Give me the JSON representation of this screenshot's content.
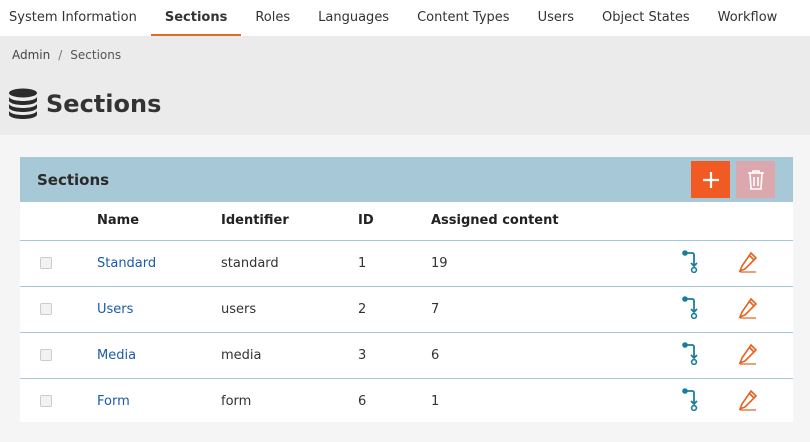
{
  "topnav": {
    "tabs": [
      {
        "label": "System Information",
        "active": false
      },
      {
        "label": "Sections",
        "active": true
      },
      {
        "label": "Roles",
        "active": false
      },
      {
        "label": "Languages",
        "active": false
      },
      {
        "label": "Content Types",
        "active": false
      },
      {
        "label": "Users",
        "active": false
      },
      {
        "label": "Object States",
        "active": false
      },
      {
        "label": "Workflow",
        "active": false
      }
    ]
  },
  "breadcrumb": {
    "root": "Admin",
    "separator": "/",
    "current": "Sections"
  },
  "page": {
    "title": "Sections",
    "icon": "database-icon"
  },
  "panel": {
    "title": "Sections",
    "add_icon": "plus-icon",
    "delete_icon": "trash-icon",
    "colors": {
      "header": "#a7c8d6",
      "add": "#f15a22",
      "delete_disabled": "#dca7ad",
      "link": "#1b5aa8",
      "assign_icon": "#1a7d9c",
      "edit_icon": "#e5611e"
    },
    "columns": [
      "Name",
      "Identifier",
      "ID",
      "Assigned content"
    ],
    "rows": [
      {
        "name": "Standard",
        "identifier": "standard",
        "id": "1",
        "assigned": "19"
      },
      {
        "name": "Users",
        "identifier": "users",
        "id": "2",
        "assigned": "7"
      },
      {
        "name": "Media",
        "identifier": "media",
        "id": "3",
        "assigned": "6"
      },
      {
        "name": "Form",
        "identifier": "form",
        "id": "6",
        "assigned": "1"
      }
    ]
  }
}
